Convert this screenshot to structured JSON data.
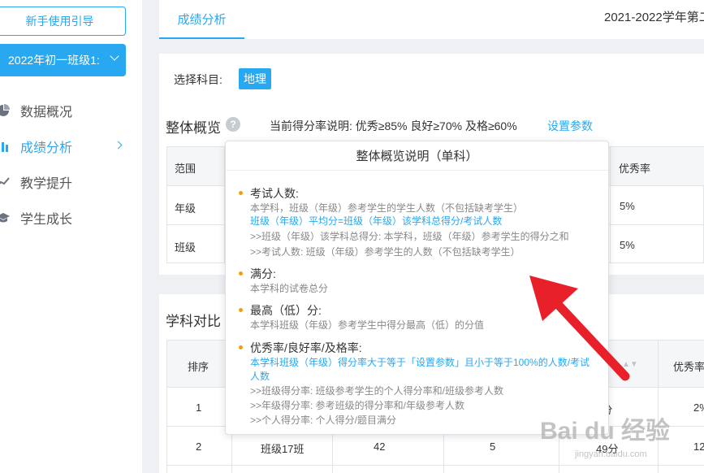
{
  "sidebar": {
    "guide_button": "新手使用引导",
    "class_select": "2022年初一班级1:",
    "items": [
      {
        "label": "数据概况",
        "icon": "pie-chart-icon"
      },
      {
        "label": "成绩分析",
        "icon": "bar-chart-icon",
        "active": true
      },
      {
        "label": "教学提升",
        "icon": "trend-line-icon"
      },
      {
        "label": "学生成长",
        "icon": "graduation-cap-icon"
      }
    ]
  },
  "topbar": {
    "active_tab": "成绩分析",
    "semester": "2021-2022学年第二"
  },
  "filter": {
    "subject_label": "选择科目:",
    "subject_value": "地理"
  },
  "overview": {
    "title": "整体概览",
    "help_icon": "?",
    "rate_desc": "当前得分率说明: 优秀≥85%  良好≥70%  及格≥60%",
    "set_params": "设置参数",
    "headers": [
      "范围",
      "优秀率"
    ],
    "rows": [
      {
        "scope": "年级",
        "excellent": "5%"
      },
      {
        "scope": "班级",
        "excellent": "5%"
      }
    ]
  },
  "compare": {
    "title": "学科对比",
    "headers": [
      "排序",
      "优秀率"
    ],
    "rows": [
      {
        "rank": "1",
        "class": "",
        "count": "",
        "absent": "",
        "avg": "9分",
        "rate": "2%"
      },
      {
        "rank": "2",
        "class": "班级17班",
        "count": "42",
        "absent": "5",
        "avg": "49分",
        "rate": "12"
      }
    ]
  },
  "popup": {
    "title": "整体概览说明（单科）",
    "items": [
      {
        "title": "考试人数:",
        "lines": [
          {
            "text": "本学科，班级（年级）参考学生的学生人数（不包括缺考学生）",
            "blue": false
          },
          {
            "text": "班级（年级）平均分=班级（年级）该学科总得分/考试人数",
            "blue": true
          },
          {
            "text": ">>班级（年级）该学科总得分: 本学科，班级（年级）参考学生的得分之和",
            "blue": false
          },
          {
            "text": ">>考试人数: 班级（年级）参考学生的人数（不包括缺考学生）",
            "blue": false
          }
        ]
      },
      {
        "title": "满分:",
        "lines": [
          {
            "text": "本学科的试卷总分",
            "blue": false
          }
        ]
      },
      {
        "title": "最高（低）分:",
        "lines": [
          {
            "text": "本学科班级（年级）参考学生中得分最高（低）的分值",
            "blue": false
          }
        ]
      },
      {
        "title": "优秀率/良好率/及格率:",
        "lines": [
          {
            "text": "本学科班级（年级）得分率大于等于「设置参数」且小于等于100%的人数/考试",
            "blue": true
          },
          {
            "text": "人数",
            "blue": true
          },
          {
            "text": ">>班级得分率: 班级参考学生的个人得分率和/班级参考人数",
            "blue": false
          },
          {
            "text": ">>年级得分率: 参考班级的得分率和/年级参考人数",
            "blue": false
          },
          {
            "text": ">>个人得分率: 个人得分/题目满分",
            "blue": false
          }
        ]
      }
    ]
  },
  "watermark": {
    "main": "Bai du 经验",
    "sub": "jingyan.baidu.com"
  },
  "colors": {
    "accent": "#27a8f0",
    "bullet": "#f39c12",
    "arrow": "#e8202a"
  }
}
